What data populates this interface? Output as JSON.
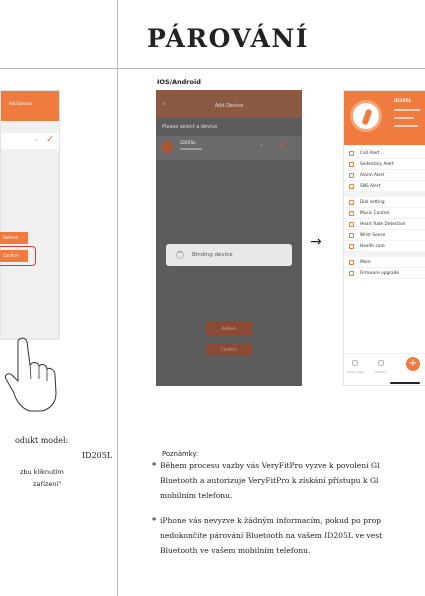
{
  "heading": "PÁROVÁNÍ",
  "platform_label": "IOS/Android",
  "left_phone": {
    "header": "Add Device",
    "button_1": "Refresh",
    "button_2": "Confirm"
  },
  "left_caption": {
    "line1": "odukt model:",
    "line2": "ID205L",
    "line3": "zbu kliknutím",
    "line4": "zařízení\""
  },
  "pairing_phone": {
    "header_title": "Add Device",
    "select_prompt": "Please select a device",
    "device_name": "ID205L",
    "binding_text": "Binding device",
    "button_refresh": "Refresh",
    "button_confirm": "Confirm"
  },
  "arrow": "→",
  "app_phone": {
    "device_name": "ID205L",
    "menu_items": [
      "Call Alert",
      "Sedentary Alert",
      "Alarm Alert",
      "SNS Alert",
      "Dial setting",
      "Music Control",
      "Heart Rate Detection",
      "Wrist Sense",
      "Health care",
      "More",
      "Firmware upgrade"
    ],
    "tabs": [
      "Home page",
      "Activity",
      "Devices"
    ],
    "plus": "+"
  },
  "notes": {
    "title": "Poznámky:",
    "star": "*",
    "note1": [
      "Během procesu vazby vás VeryFitPro vyzve k povolení Gl",
      "Bluetooth a autorizuje VeryFitPro k získání přístupu k Gl",
      "mobilním telefonu."
    ],
    "note2": [
      "iPhone vás nevyzve k žádným informacím, pokud po prop",
      "nedokončíte párování Bluetooth na vašem ID205L ve vest",
      "Bluetooth ve vašem mobilním telefonu."
    ]
  }
}
